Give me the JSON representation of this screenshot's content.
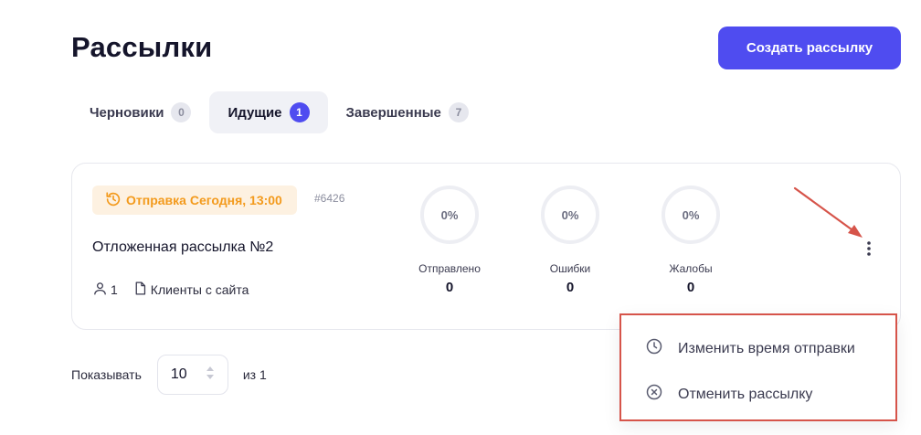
{
  "header": {
    "title": "Рассылки",
    "create_button": "Создать рассылку"
  },
  "tabs": [
    {
      "label": "Черновики",
      "count": "0",
      "active": false
    },
    {
      "label": "Идущие",
      "count": "1",
      "active": true
    },
    {
      "label": "Завершенные",
      "count": "7",
      "active": false
    }
  ],
  "campaign": {
    "schedule": "Отправка Сегодня, 13:00",
    "id": "#6426",
    "name": "Отложенная рассылка №2",
    "recipients": "1",
    "source": "Клиенты с сайта",
    "stats": [
      {
        "percent": "0%",
        "label": "Отправлено",
        "value": "0"
      },
      {
        "percent": "0%",
        "label": "Ошибки",
        "value": "0"
      },
      {
        "percent": "0%",
        "label": "Жалобы",
        "value": "0"
      }
    ]
  },
  "menu": {
    "items": [
      {
        "label": "Изменить время отправки",
        "icon": "clock-icon"
      },
      {
        "label": "Отменить рассылку",
        "icon": "cancel-circle-icon"
      }
    ]
  },
  "pagination": {
    "show_label": "Показывать",
    "page_size": "10",
    "of_label": "из 1"
  },
  "colors": {
    "accent": "#4f4cf0",
    "schedule": "#f39a1c",
    "highlight": "#d6544a"
  }
}
